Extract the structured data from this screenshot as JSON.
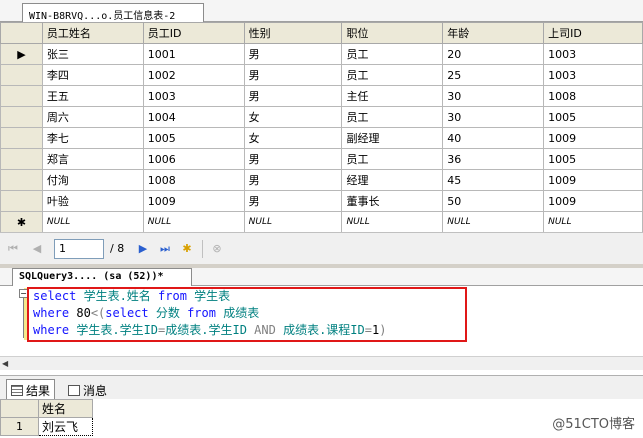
{
  "top_tab": {
    "label": "WIN-B8RVQ...o.员工信息表-2"
  },
  "grid": {
    "columns": [
      "员工姓名",
      "员工ID",
      "性别",
      "职位",
      "年龄",
      "上司ID"
    ],
    "rows": [
      [
        "张三",
        "1001",
        "男",
        "员工",
        "20",
        "1003"
      ],
      [
        "李四",
        "1002",
        "男",
        "员工",
        "25",
        "1003"
      ],
      [
        "王五",
        "1003",
        "男",
        "主任",
        "30",
        "1008"
      ],
      [
        "周六",
        "1004",
        "女",
        "员工",
        "30",
        "1005"
      ],
      [
        "李七",
        "1005",
        "女",
        "副经理",
        "40",
        "1009"
      ],
      [
        "郑言",
        "1006",
        "男",
        "员工",
        "36",
        "1005"
      ],
      [
        "付洵",
        "1008",
        "男",
        "经理",
        "45",
        "1009"
      ],
      [
        "叶验",
        "1009",
        "男",
        "董事长",
        "50",
        "1009"
      ]
    ],
    "current_row_marker": "▶",
    "new_row_marker": "✱",
    "null_text": "NULL"
  },
  "navigator": {
    "current_page": "1",
    "total": "/ 8"
  },
  "query_tab": {
    "label": "SQLQuery3.... (sa (52))*"
  },
  "editor": {
    "collapse_glyph": "−",
    "line1": {
      "kw1": "select",
      "ident1": " 学生表.姓名 ",
      "kw2": "from",
      "ident2": " 学生表"
    },
    "line2": {
      "kw1": "where",
      "num": " 80",
      "op1": "<(",
      "kw2": "select",
      "ident1": " 分数 ",
      "kw3": "from",
      "ident2": " 成绩表"
    },
    "line3": {
      "kw1": "where",
      "ident1": " 学生表.学生ID",
      "op1": "=",
      "ident2": "成绩表.学生ID ",
      "kw2": "AND",
      "ident3": " 成绩表.课程ID",
      "op2": "=",
      "num": "1",
      "op3": ")"
    }
  },
  "results_tabs": {
    "results_label": "结果",
    "messages_label": "消息"
  },
  "results": {
    "column": "姓名",
    "row_number": "1",
    "value": "刘云飞"
  },
  "watermark": "@51CTO博客"
}
